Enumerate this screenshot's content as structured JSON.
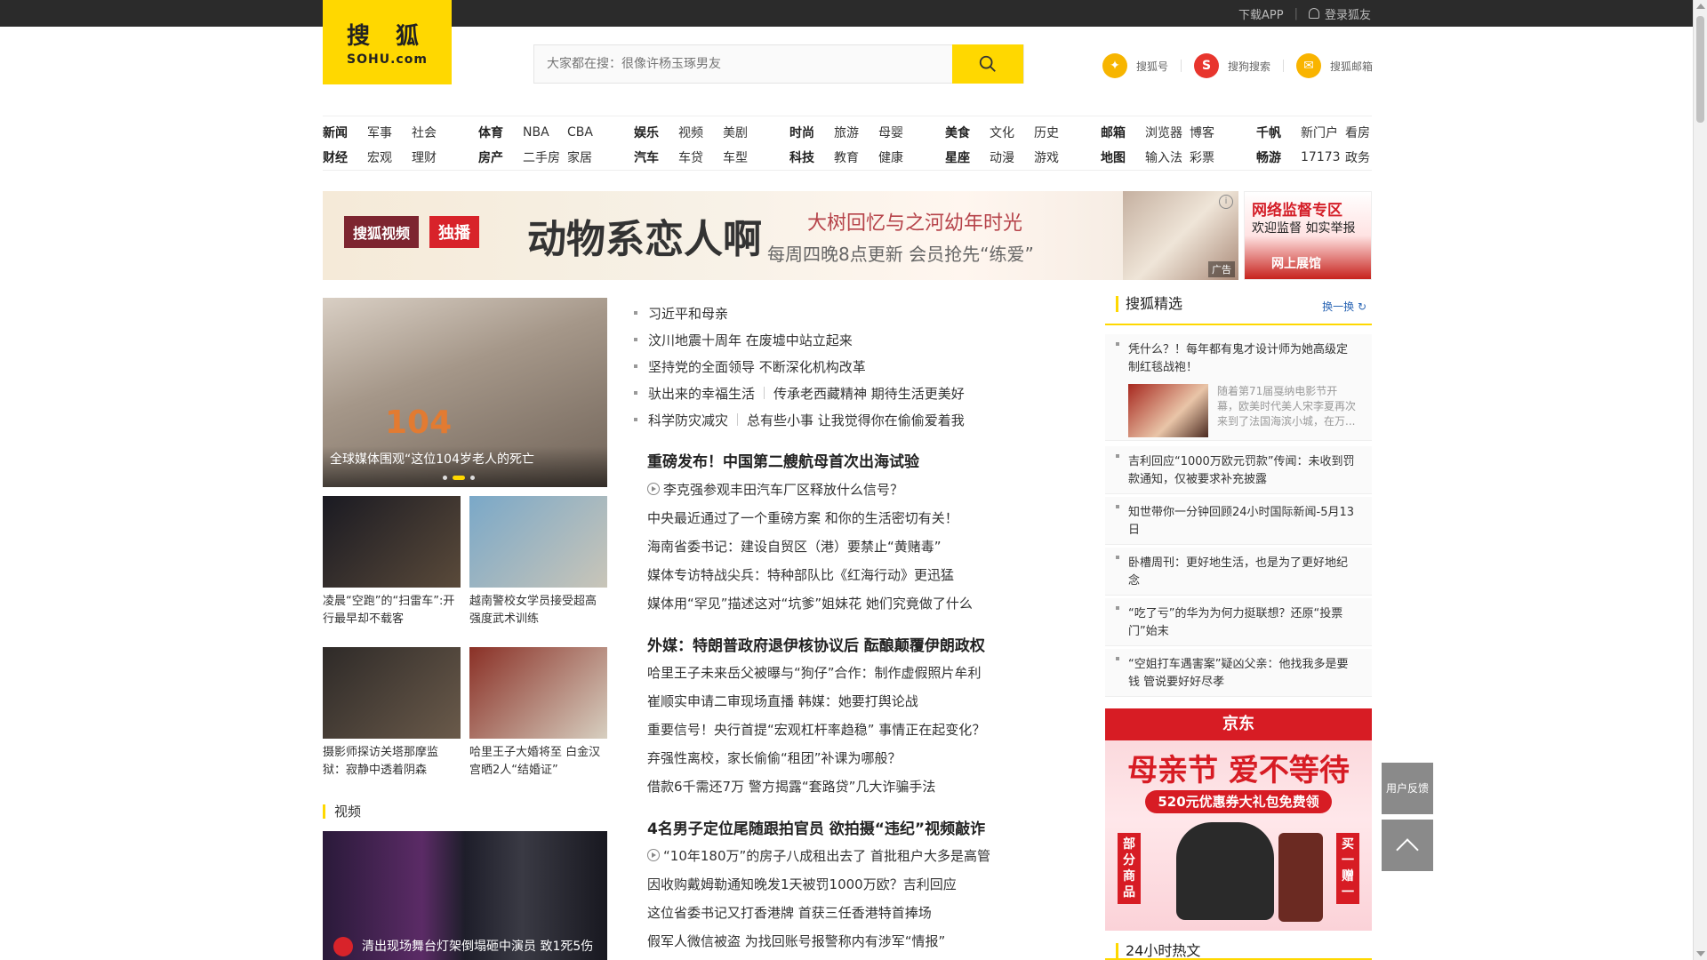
{
  "topbar": {
    "download_app": "下载APP",
    "login": "登录狐友"
  },
  "logo": {
    "line1": "搜 狐",
    "line2": "SOHU.com"
  },
  "search": {
    "placeholder": "大家都在搜：很像许杨玉琢男友"
  },
  "header_links": [
    {
      "label": "搜狐号",
      "icon": "sohu-account-icon",
      "color": "#f7b500"
    },
    {
      "label": "搜狗搜索",
      "icon": "sogou-icon",
      "color": "#e8352d"
    },
    {
      "label": "搜狐邮箱",
      "icon": "mail-icon",
      "color": "#f9b400"
    }
  ],
  "nav": [
    {
      "r1": [
        "新闻",
        "军事",
        "社会"
      ],
      "r2": [
        "财经",
        "宏观",
        "理财"
      ]
    },
    {
      "r1": [
        "体育",
        "NBA",
        "CBA"
      ],
      "r2": [
        "房产",
        "二手房",
        "家居"
      ]
    },
    {
      "r1": [
        "娱乐",
        "视频",
        "美剧"
      ],
      "r2": [
        "汽车",
        "车贷",
        "车型"
      ]
    },
    {
      "r1": [
        "时尚",
        "旅游",
        "母婴"
      ],
      "r2": [
        "科技",
        "教育",
        "健康"
      ]
    },
    {
      "r1": [
        "美食",
        "文化",
        "历史"
      ],
      "r2": [
        "星座",
        "动漫",
        "游戏"
      ]
    },
    {
      "r1": [
        "邮箱",
        "浏览器",
        "博客"
      ],
      "r2": [
        "地图",
        "输入法",
        "彩票"
      ]
    },
    {
      "r1": [
        "千帆",
        "新门户",
        "看房"
      ],
      "r2": [
        "畅游",
        "17173",
        "政务"
      ]
    }
  ],
  "banner": {
    "brand": "搜狐视频",
    "exclusive": "独播",
    "show": "动物系恋人啊",
    "slogan1": "大树回忆与之河幼年时光",
    "slogan2": "每周四晚8点更新  会员抢先“练爱”",
    "ad_label": "广告"
  },
  "side_ad": {
    "t1": "网络监督专区",
    "t2": "欢迎监督 如实举报",
    "t3": "网上展馆"
  },
  "focus": {
    "caption": "全球媒体围观“这位104岁老人的死亡",
    "cake_text": "104"
  },
  "thumbs": [
    {
      "title": "凌晨“空跑”的“扫雷车”:开行最早却不载客",
      "colors": [
        "#1a1a22",
        "#5a4a3a"
      ]
    },
    {
      "title": "越南警校女学员接受超高强度武术训练",
      "colors": [
        "#7aa8c8",
        "#c9c5b8"
      ]
    },
    {
      "title": "摄影师探访关塔那摩监狱：寂静中透着阴森",
      "colors": [
        "#2e2a28",
        "#6a5a4a"
      ]
    },
    {
      "title": "哈里王子大婚将至 白金汉宫晒2人“结婚证”",
      "colors": [
        "#8a3026",
        "#d7cfc0"
      ]
    }
  ],
  "video_section": {
    "title": "视频",
    "caption": "清出现场舞台灯架倒塌砸中演员 致1死5伤"
  },
  "news": {
    "block1": [
      {
        "text": "习近平和母亲"
      },
      {
        "text": "汶川地震十周年 在废墟中站立起来"
      },
      {
        "text": "坚持党的全面领导 不断深化机构改革"
      },
      {
        "text": "驮出来的幸福生活",
        "text2": "传承老西藏精神 期待生活更美好"
      },
      {
        "text": "科学防灾减灾",
        "text2": "总有些小事 让我觉得你在偷偷爱着我"
      }
    ],
    "head1": "重磅发布！中国第二艘航母首次出海试验",
    "block2": [
      {
        "text": "李克强参观丰田汽车厂区释放什么信号？",
        "video": true
      },
      {
        "text": "中央最近通过了一个重磅方案 和你的生活密切有关！"
      },
      {
        "text": "海南省委书记：建设自贸区（港）要禁止“黄赌毒”"
      },
      {
        "text": "媒体专访特战尖兵：特种部队比《红海行动》更迅猛"
      },
      {
        "text": "媒体用“罕见”描述这对“坑爹”姐妹花 她们究竟做了什么"
      }
    ],
    "head2": "外媒：特朗普政府退伊核协议后 酝酿颠覆伊朗政权",
    "block3": [
      {
        "text": "哈里王子未来岳父被曝与“狗仔”合作：制作虚假照片牟利"
      },
      {
        "text": "崔顺实申请二审现场直播 韩媒：她要打舆论战"
      },
      {
        "text": "重要信号！央行首提“宏观杠杆率趋稳” 事情正在起变化？"
      },
      {
        "text": "弃强性离校，家长偷偷“租团”补课为哪般？"
      },
      {
        "text": "借款6千需还7万 警方揭露“套路贷”几大诈骗手法"
      }
    ],
    "head3": "4名男子定位尾随跟拍官员 欲拍摄“违纪”视频敲诈",
    "block4": [
      {
        "text": "“10年180万”的房子八成租出去了 首批租户大多是高管",
        "video": true
      },
      {
        "text": "因收购戴姆勒通知晚发1天被罚1000万欧？吉利回应"
      },
      {
        "text": "这位省委书记又打香港牌 首获三任香港特首捧场"
      },
      {
        "text": "假军人微信被盗 为找回账号报警称内有涉军“情报”"
      }
    ]
  },
  "picks": {
    "title": "搜狐精选",
    "refresh": "换一换",
    "items": [
      {
        "text": "凭什么？！每年都有鬼才设计师为她高级定制红毯战袍！",
        "sub": "随着第71届戛纳电影节开幕，欧美时代美人宋李夏再次来到了法国海滨小城，在万..."
      },
      {
        "text": "吉利回应“1000万欧元罚款”传闻：未收到罚款通知，仅被要求补充披露"
      },
      {
        "text": "知世带你一分钟回顾24小时国际新闻-5月13日"
      },
      {
        "text": "卧槽周刊：更好地生活，也是为了更好地纪念"
      },
      {
        "text": "“吃了亏”的华为为何力挺联想？还原“投票门”始末"
      },
      {
        "text": "“空姐打车遇害案”疑凶父亲：他找我多是要钱 管说要好好尽孝"
      }
    ],
    "title2": "24小时热文"
  },
  "jd_ad": {
    "brand": "京东",
    "h1": "母亲节 爱不等待",
    "h2": "520元优惠券大礼包免费领",
    "v1": "部分商品",
    "v2": "买一赠一"
  },
  "floating": {
    "feedback": "用户反馈"
  }
}
